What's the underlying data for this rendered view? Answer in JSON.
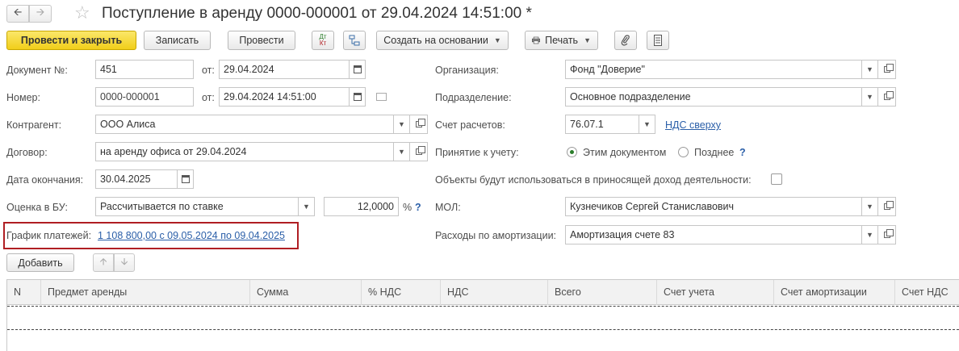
{
  "window": {
    "title": "Поступление в аренду 0000-000001 от 29.04.2024 14:51:00 *",
    "back_icon": "arrow-left-icon",
    "forward_icon": "arrow-right-icon",
    "favorite_icon": "star-icon"
  },
  "toolbar": {
    "post_close": "Провести и закрыть",
    "save": "Записать",
    "post": "Провести",
    "dtkt_top": "Дт",
    "dtkt_bottom": "Кт",
    "create_based_on": "Создать на основании",
    "print": "Печать",
    "attach_icon": "paperclip-icon",
    "list_icon": "document-list-icon",
    "structure_icon": "structure-icon"
  },
  "form": {
    "doc_number_label": "Документ №:",
    "doc_number": "451",
    "from_label": "от:",
    "doc_date": "29.04.2024",
    "number_label": "Номер:",
    "number": "0000-000001",
    "number_from_label": "от:",
    "number_date": "29.04.2024 14:51:00",
    "contractor_label": "Контрагент:",
    "contractor": "ООО Алиса",
    "contract_label": "Договор:",
    "contract": "на аренду офиса от 29.04.2024",
    "end_date_label": "Дата окончания:",
    "end_date": "30.04.2025",
    "assessment_label": "Оценка в БУ:",
    "assessment": "Рассчитывается по ставке",
    "rate": "12,0000",
    "rate_unit": "%",
    "rate_help": "?",
    "schedule_label": "График платежей:",
    "schedule_link": "1 108 800,00 с 09.05.2024 по 09.04.2025",
    "organization_label": "Организация:",
    "organization": "Фонд \"Доверие\"",
    "department_label": "Подразделение:",
    "department": "Основное подразделение",
    "account_label": "Счет расчетов:",
    "account": "76.07.1",
    "vat_link": "НДС сверху",
    "acceptance_label": "Принятие к учету:",
    "acceptance_option1": "Этим документом",
    "acceptance_option2": "Позднее",
    "acceptance_help": "?",
    "acceptance_selected": "Этим документом",
    "income_label": "Объекты будут использоваться в приносящей доход деятельности:",
    "income_checked": false,
    "mol_label": "МОЛ:",
    "mol": "Кузнечиков Сергей Станиславович",
    "amortization_label": "Расходы по амортизации:",
    "amortization": "Амортизация счете 83"
  },
  "table": {
    "add_button": "Добавить",
    "columns": [
      "N",
      "Предмет аренды",
      "Сумма",
      "% НДС",
      "НДС",
      "Всего",
      "Счет учета",
      "Счет амортизации",
      "Счет НДС"
    ],
    "rows": []
  },
  "colors": {
    "primary_button": "#f1ce1a",
    "link": "#2a5ea8",
    "highlight_border": "#b01e23"
  }
}
